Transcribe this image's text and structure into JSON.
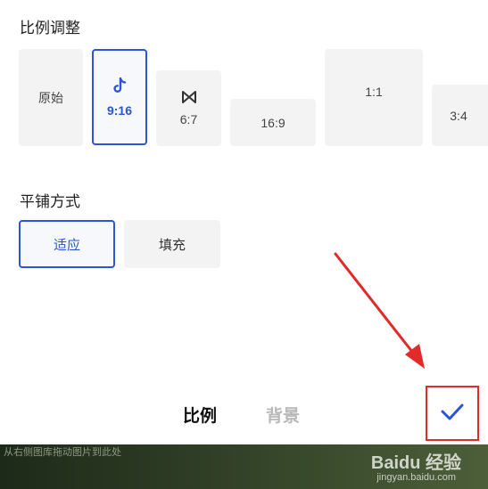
{
  "ratio_section": {
    "title": "比例调整",
    "items": [
      {
        "label": "原始",
        "icon": ""
      },
      {
        "label": "9:16",
        "icon": "tiktok-icon"
      },
      {
        "label": "6:7",
        "icon": "capcut-icon"
      },
      {
        "label": "16:9",
        "icon": ""
      },
      {
        "label": "1:1",
        "icon": ""
      },
      {
        "label": "3:4",
        "icon": ""
      }
    ],
    "selected": "9:16"
  },
  "fill_section": {
    "title": "平铺方式",
    "options": [
      "适应",
      "填充"
    ],
    "selected": "适应"
  },
  "bottom_tabs": [
    "比例",
    "背景"
  ],
  "active_tab": "比例",
  "confirm_icon": "check-icon",
  "accent_color": "#2b55d6",
  "annotation_color": "#e22a2a",
  "footer": {
    "caption": "从右侧图库拖动图片到此处",
    "watermark": "Baidu 经验",
    "watermark_sub": "jingyan.baidu.com"
  }
}
